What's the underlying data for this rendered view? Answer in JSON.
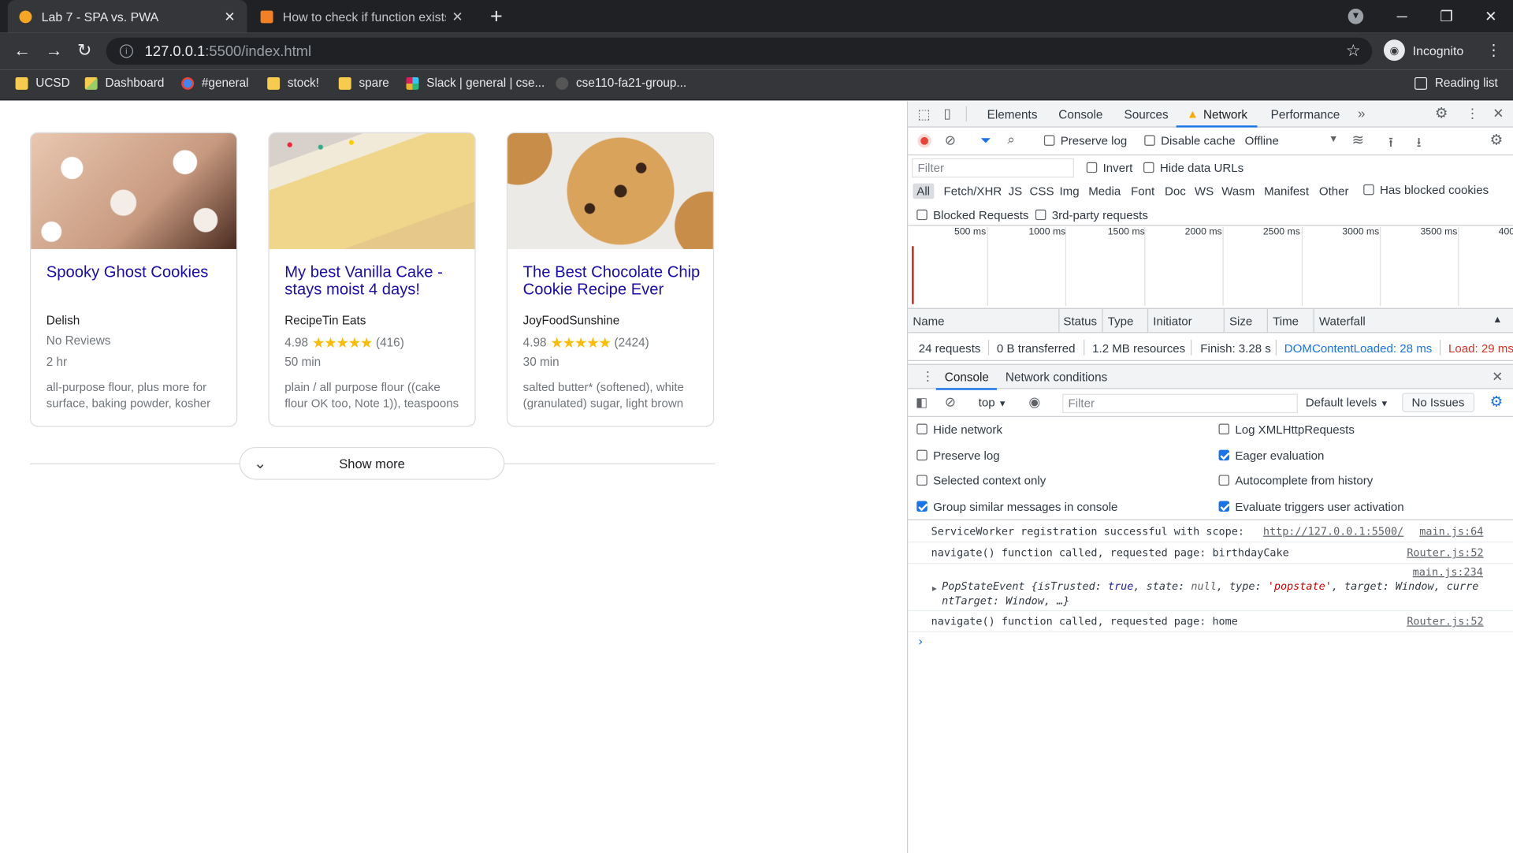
{
  "browser": {
    "tabs": [
      {
        "title": "Lab 7 - SPA vs. PWA"
      },
      {
        "title": "How to check if function exists in"
      }
    ],
    "url_host": "127.0.0.1",
    "url_path": ":5500/index.html",
    "profile_label": "Incognito",
    "bookmarks": [
      "UCSD",
      "Dashboard",
      "#general",
      "stock!",
      "spare",
      "Slack | general | cse...",
      "cse110-fa21-group..."
    ],
    "reading_list": "Reading list"
  },
  "page": {
    "cards": [
      {
        "title": "Spooky Ghost Cookies",
        "source": "Delish",
        "rating_text": "No Reviews",
        "rating": null,
        "reviews": null,
        "time": "2 hr",
        "ingredients": "all-purpose flour, plus more for surface, baking powder, kosher"
      },
      {
        "title": "My best Vanilla Cake - stays moist 4 days!",
        "source": "RecipeTin Eats",
        "rating_text": "4.98",
        "rating": 4.98,
        "reviews": "(416)",
        "time": "50 min",
        "ingredients": "plain / all purpose flour ((cake flour OK too, Note 1)), teaspoons"
      },
      {
        "title": "The Best Chocolate Chip Cookie Recipe Ever",
        "source": "JoyFoodSunshine",
        "rating_text": "4.98",
        "rating": 4.98,
        "reviews": "(2424)",
        "time": "30 min",
        "ingredients": "salted butter* (softened), white (granulated) sugar, light brown"
      }
    ],
    "show_more": "Show more",
    "stars": "★★★★★"
  },
  "devtools": {
    "tabs": [
      "Elements",
      "Console",
      "Sources",
      "Network",
      "Performance"
    ],
    "active_tab": "Network",
    "toolbar": {
      "preserve_log": "Preserve log",
      "disable_cache": "Disable cache",
      "throttle": "Offline"
    },
    "filter_placeholder": "Filter",
    "invert": "Invert",
    "hide_data_urls": "Hide data URLs",
    "types": [
      "All",
      "Fetch/XHR",
      "JS",
      "CSS",
      "Img",
      "Media",
      "Font",
      "Doc",
      "WS",
      "Wasm",
      "Manifest",
      "Other"
    ],
    "has_blocked_cookies": "Has blocked cookies",
    "blocked_requests": "Blocked Requests",
    "third_party": "3rd-party requests",
    "timeline_ticks": [
      "500 ms",
      "1000 ms",
      "1500 ms",
      "2000 ms",
      "2500 ms",
      "3000 ms",
      "3500 ms",
      "400"
    ],
    "columns": [
      "Name",
      "Status",
      "Type",
      "Initiator",
      "Size",
      "Time",
      "Waterfall"
    ],
    "summary": {
      "requests": "24 requests",
      "transferred": "0 B transferred",
      "resources": "1.2 MB resources",
      "finish": "Finish: 3.28 s",
      "dcl": "DOMContentLoaded: 28 ms",
      "load": "Load: 29 ms"
    },
    "drawer": {
      "tabs": [
        "Console",
        "Network conditions"
      ],
      "context": "top",
      "filter_placeholder": "Filter",
      "levels": "Default levels",
      "issues": "No Issues",
      "settings_left": [
        {
          "label": "Hide network",
          "checked": false
        },
        {
          "label": "Preserve log",
          "checked": false
        },
        {
          "label": "Selected context only",
          "checked": false
        },
        {
          "label": "Group similar messages in console",
          "checked": true
        }
      ],
      "settings_right": [
        {
          "label": "Log XMLHttpRequests",
          "checked": false
        },
        {
          "label": "Eager evaluation",
          "checked": true
        },
        {
          "label": "Autocomplete from history",
          "checked": false
        },
        {
          "label": "Evaluate triggers user activation",
          "checked": true
        }
      ],
      "logs": [
        {
          "text": "ServiceWorker registration successful with scope: ",
          "link": "http://127.0.0.1:5500/",
          "source": "main.js:64"
        },
        {
          "text": "navigate() function called, requested page: birthdayCake",
          "source": "Router.js:52"
        },
        {
          "source": "main.js:234",
          "obj_name": "PopStateEvent",
          "obj_l1a": " {isTrusted: ",
          "obj_true": "true",
          "obj_l1b": ", state: ",
          "obj_null": "null",
          "obj_l1c": ", type: ",
          "obj_type": "'popstate'",
          "obj_l1d": ", target: Window, curre",
          "obj_l2": "ntTarget: Window, …}"
        },
        {
          "text": "navigate() function called, requested page: home",
          "source": "Router.js:52"
        }
      ]
    }
  },
  "colors": {
    "chrome_dark": "#202124",
    "chrome_mid": "#35363a",
    "link_blue": "#1a0dab",
    "star": "#fbbc04",
    "accent": "#1a73e8",
    "load_red": "#d93025"
  }
}
